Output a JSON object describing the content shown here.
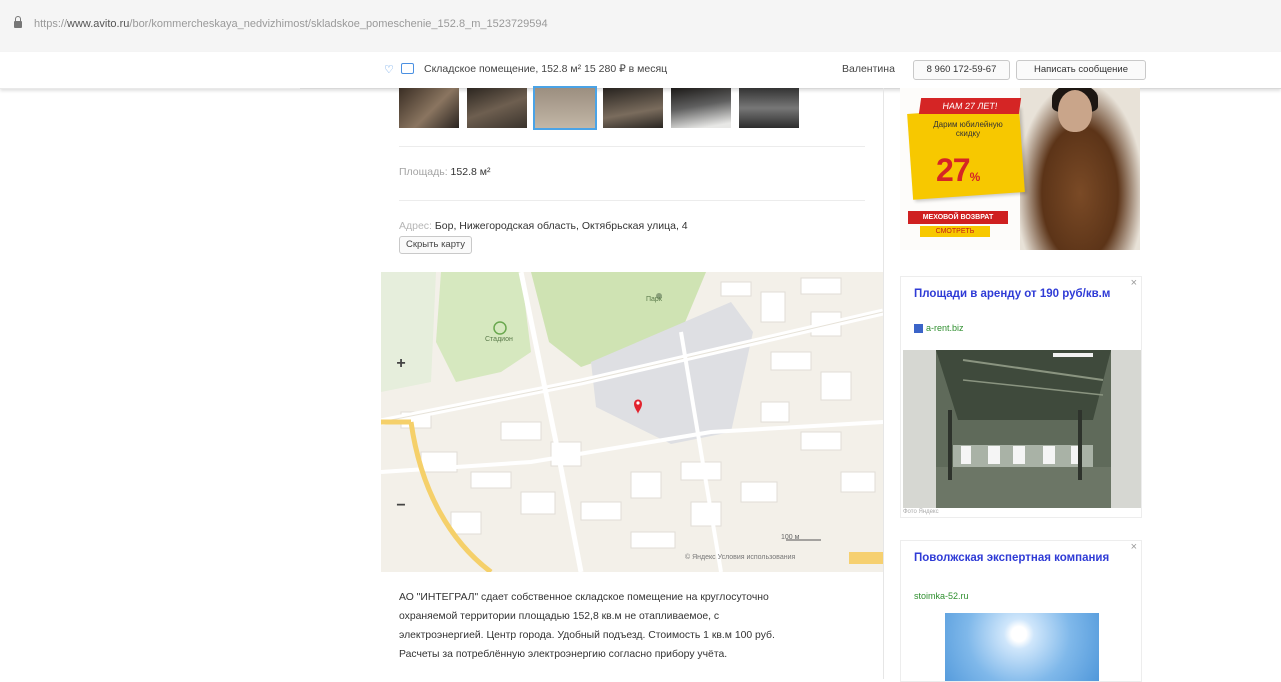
{
  "browser": {
    "url_prefix": "https://",
    "url_domain": "www.avito.ru",
    "url_path": "/bor/kommercheskaya_nedvizhimost/skladskoe_pomeschenie_152.8_m_1523729594"
  },
  "sticky_header": {
    "title": "Складское помещение, 152.8 м²   15 280 ₽ в месяц",
    "seller": "Валентина",
    "phone": "8 960 172-59-67",
    "message_button": "Написать сообщение"
  },
  "listing": {
    "area_label": "Площадь:",
    "area_value": "152.8 м²",
    "address_label": "Адрес:",
    "address_value": "Бор, Нижегородская область, Октябрьская улица, 4",
    "hide_map_button": "Скрыть карту",
    "map": {
      "zoom_in": "+",
      "zoom_out": "−",
      "park_label_1": "Парк",
      "park_label_2": "Стадион",
      "scale": "100 м",
      "copyright": "© Яндекс  Условия использования"
    },
    "description": [
      "АО \"ИНТЕГРАЛ\" сдает собственное складское помещение на круглосуточно",
      "охраняемой территории площадью 152,8 кв.м не отапливаемое, с",
      "электроэнергией. Центр города. Удобный подъезд. Стоимость 1 кв.м 100 руб.",
      "Расчеты за потреблённую электроэнергию согласно прибору учёта."
    ]
  },
  "ads": {
    "ad1": {
      "banner_top": "НАМ 27 ЛЕТ!",
      "gift_text": "Дарим юбилейную скидку",
      "percent": "27",
      "percent_sign": "%",
      "strip_text": "МЕХОВОЙ ВОЗВРАТ",
      "strip_text2": "СМОТРЕТЬ"
    },
    "ad2": {
      "title": "Площади в аренду от 190 руб/кв.м",
      "domain": "a-rent.biz",
      "caption": "Фото Яндекс",
      "close": "×"
    },
    "ad3": {
      "title": "Поволжская экспертная компания",
      "domain": "stoimka-52.ru",
      "close": "×"
    }
  }
}
